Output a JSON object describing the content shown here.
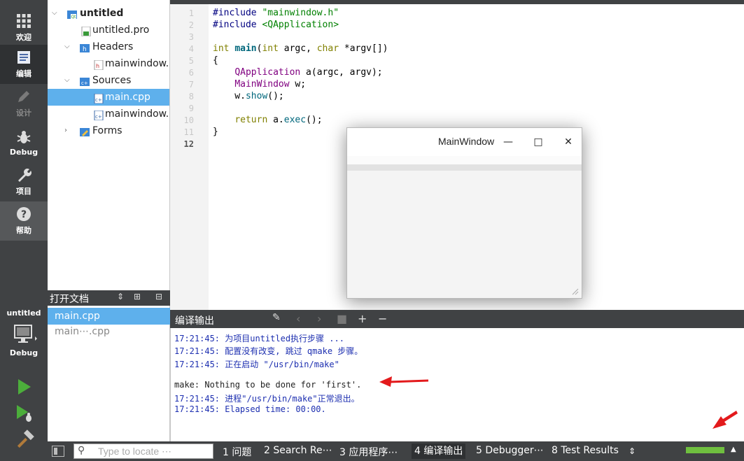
{
  "modebar": {
    "modes": [
      {
        "label": "欢迎",
        "icon": "grid-icon"
      },
      {
        "label": "编辑",
        "icon": "document-icon"
      },
      {
        "label": "设计",
        "icon": "pencil-icon"
      },
      {
        "label": "Debug",
        "icon": "bug-icon"
      },
      {
        "label": "项目",
        "icon": "wrench-icon"
      },
      {
        "label": "帮助",
        "icon": "help-icon"
      }
    ],
    "kit_project": "untitled",
    "kit_build": "Debug"
  },
  "tree": {
    "items": [
      {
        "label": "untitled",
        "icon": "qt-project-icon"
      },
      {
        "label": "untitled.pro",
        "icon": "pro-file-icon"
      },
      {
        "label": "Headers",
        "icon": "folder-h-icon"
      },
      {
        "label": "mainwindow.h",
        "icon": "header-file-icon"
      },
      {
        "label": "Sources",
        "icon": "folder-cpp-icon"
      },
      {
        "label": "main.cpp",
        "icon": "cpp-file-icon"
      },
      {
        "label": "mainwindow.cpp",
        "icon": "cpp-file-icon"
      },
      {
        "label": "Forms",
        "icon": "folder-forms-icon"
      }
    ]
  },
  "open_docs": {
    "title": "打开文档",
    "items": [
      {
        "label": "main.cpp"
      },
      {
        "label": "main⋯.cpp"
      }
    ]
  },
  "editor": {
    "line_numbers": [
      "1",
      "2",
      "3",
      "4",
      "5",
      "6",
      "7",
      "8",
      "9",
      "10",
      "11",
      "12"
    ],
    "lines": {
      "l1a": "#include ",
      "l1b": "\"mainwindow.h\"",
      "l2a": "#include ",
      "l2b": "<QApplication>",
      "l4a": "int ",
      "l4b": "main",
      "l4c": "(",
      "l4d": "int",
      "l4e": " argc, ",
      "l4f": "char",
      "l4g": " *argv[])",
      "l5": "{",
      "l6a": "    ",
      "l6b": "QApplication",
      "l6c": " a(argc, argv);",
      "l7a": "    ",
      "l7b": "MainWindow",
      "l7c": " w;",
      "l8a": "    w.",
      "l8b": "show",
      "l8c": "();",
      "l10a": "    ",
      "l10b": "return",
      "l10c": " a.",
      "l10d": "exec",
      "l10e": "();",
      "l11": "}"
    }
  },
  "main_window": {
    "title": "MainWindow",
    "minimize": "—",
    "maximize": "□",
    "close": "✕"
  },
  "output": {
    "title": "编译输出",
    "lines": [
      "17:21:45: 为项目untitled执行步骤 ...",
      "17:21:45: 配置没有改变, 跳过 qmake 步骤。",
      "17:21:45: 正在启动 \"/usr/bin/make\"",
      "make: Nothing to be done for 'first'.",
      "17:21:45: 进程\"/usr/bin/make\"正常退出。",
      "17:21:45: Elapsed time: 00:00."
    ]
  },
  "status": {
    "locate_placeholder": "Type to locate ⋯",
    "tabs": [
      "1  问题",
      "2  Search Re⋯",
      "3  应用程序⋯",
      "4  编译输出",
      "5  Debugger⋯",
      "8  Test Results"
    ],
    "build_progress": 1.0
  },
  "colors": {
    "selection": "#5eb0ec",
    "arrow_red": "#e31a1c",
    "progress_green": "#6fbf3f"
  }
}
